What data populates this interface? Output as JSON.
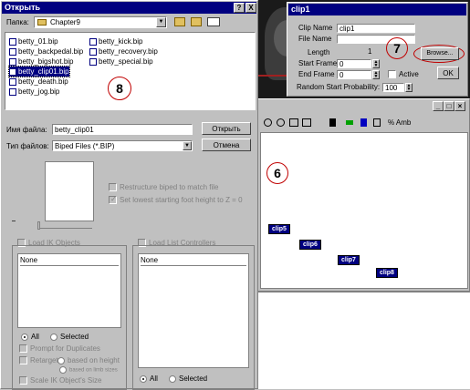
{
  "open_dialog": {
    "title": "Открыть",
    "help_btn": "?",
    "close_btn": "X",
    "folder_label": "Папка:",
    "folder_value": "Chapter9",
    "files_col1": [
      "betty_01.bip",
      "betty_backpedal.bip",
      "betty_bigshot.bip",
      "betty_clip01.bip",
      "betty_death.bip",
      "betty_jog.bip"
    ],
    "files_col2": [
      "betty_kick.bip",
      "betty_recovery.bip",
      "betty_special.bip"
    ],
    "selected_file": "betty_clip01.bip",
    "annotation_8": "8",
    "filename_label": "Имя файла:",
    "filename_value": "betty_clip01",
    "filetype_label": "Тип файлов:",
    "filetype_value": "Biped Files (*.BIP)",
    "open_btn": "Открыть",
    "cancel_btn": "Отмена",
    "restructure_label": "Restructure biped to match file",
    "set_lowest_label": "Set lowest starting foot height to Z = 0",
    "load_ik_label": "Load IK Objects",
    "load_list_label": "Load List Controllers",
    "list_left_header": "None",
    "list_right_header": "None",
    "radio_all_left": "All",
    "radio_selected_left": "Selected",
    "radio_all_right": "All",
    "radio_selected_right": "Selected",
    "prompt_duplicates": "Prompt for Duplicates",
    "retarget_label": "Retarget",
    "based_on_height": "based on height",
    "based_on_limb": "based on limb sizes",
    "scale_ik_label": "Scale IK Object's Size"
  },
  "clip_dialog": {
    "title": "clip1",
    "clip_name_label": "Clip Name",
    "clip_name_value": "clip1",
    "file_name_label": "File Name",
    "file_name_value": "",
    "length_label": "Length",
    "length_value": "1",
    "start_frame_label": "Start Frame",
    "start_frame_value": "0",
    "end_frame_label": "End Frame",
    "end_frame_value": "0",
    "active_label": "Active",
    "random_label": "Random Start Probability:",
    "random_value": "100",
    "browse_btn": "Browse...",
    "ok_btn": "OK",
    "annotation_7": "7"
  },
  "motion_mixer": {
    "toolbar_text": "% Amb",
    "annotation_6": "6",
    "clips": [
      "clip5",
      "clip6",
      "clip7",
      "clip8"
    ]
  },
  "colors": {
    "title_bar": "#000080",
    "face_gray": "#c0c0c0",
    "annotation_red": "#c00000",
    "dark_viewport": "#1a1a1a"
  }
}
